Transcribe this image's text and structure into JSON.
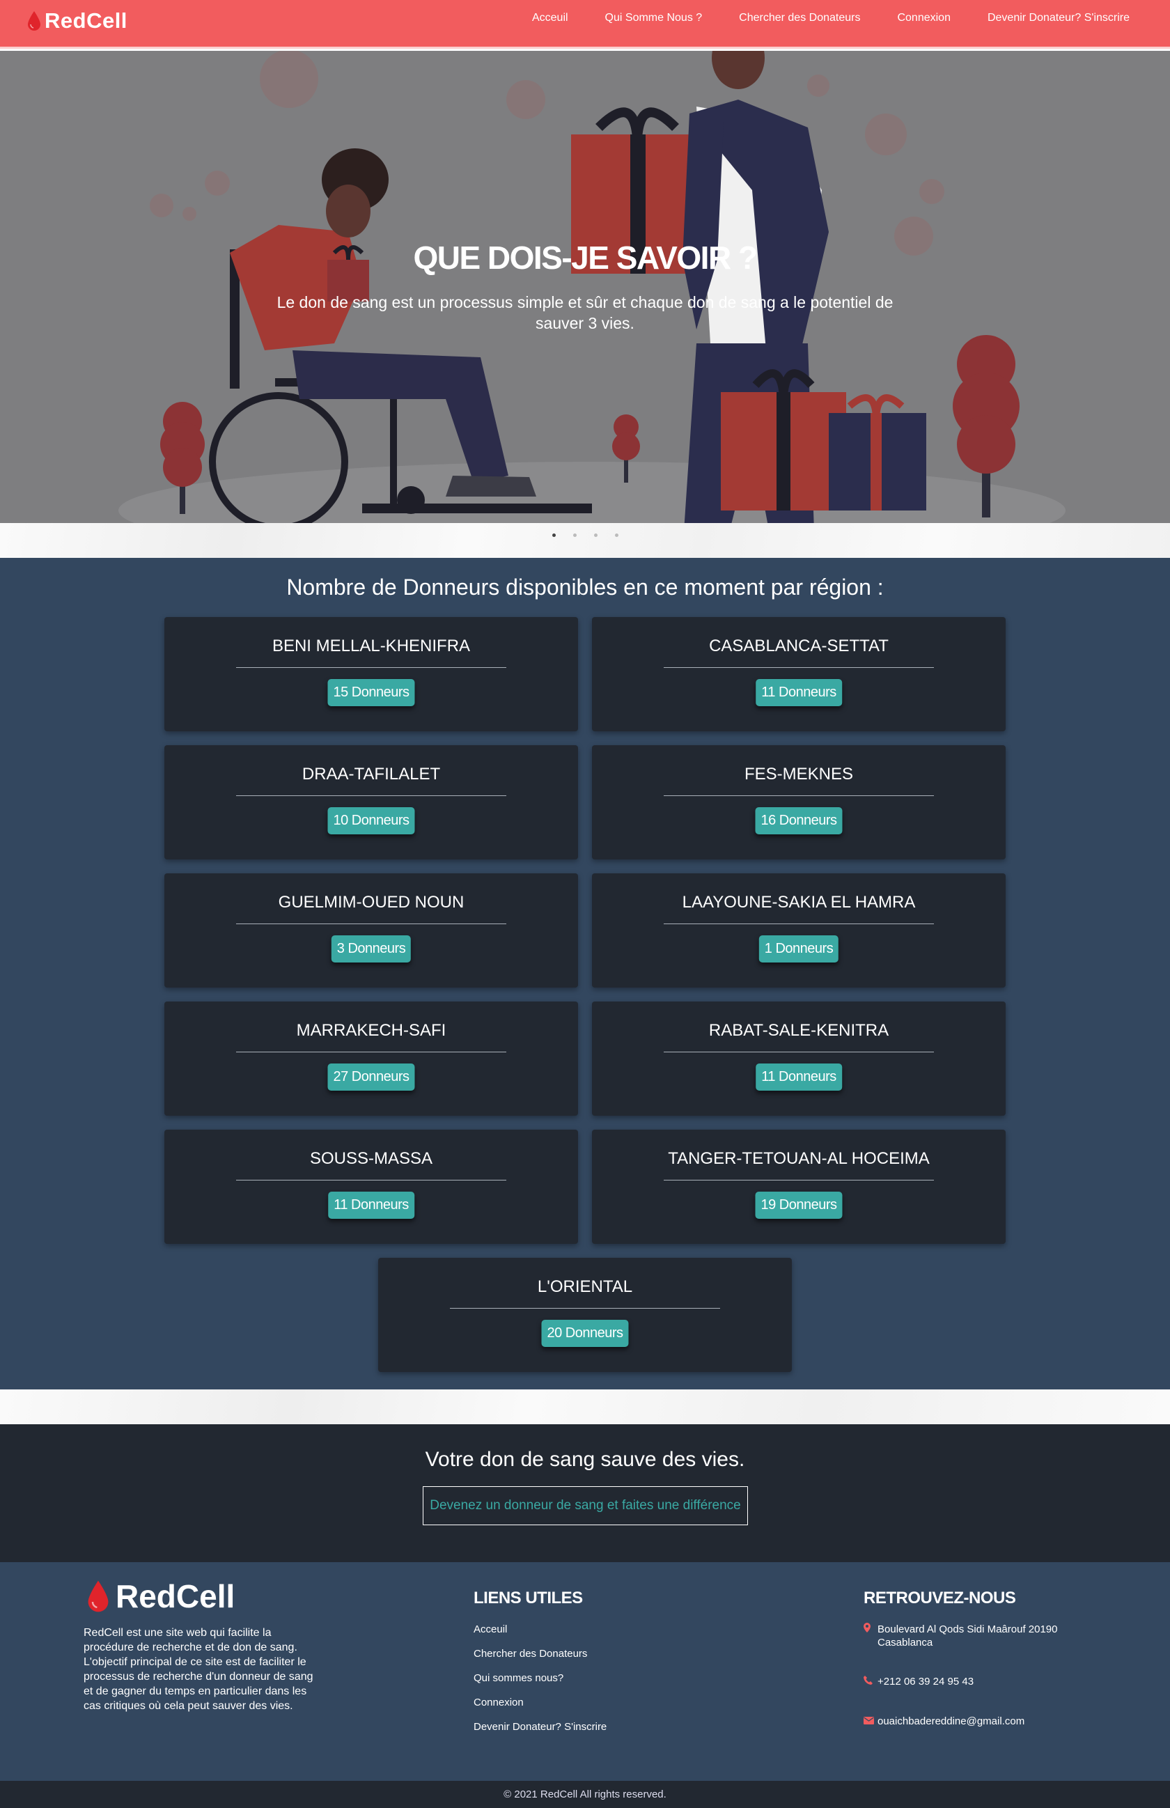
{
  "navbar": {
    "brand": "RedCell",
    "links": [
      "Acceuil",
      "Qui Somme Nous ?",
      "Chercher des Donateurs",
      "Connexion",
      "Devenir Donateur? S'inscrire"
    ]
  },
  "hero": {
    "title": "QUE DOIS-JE SAVOIR ?",
    "subtitle": "Le don de sang est un processus simple et sûr et chaque don de sang a le potentiel de sauver 3 vies.",
    "slide_count": 4,
    "active_slide": 1
  },
  "donors": {
    "heading": "Nombre de Donneurs disponibles en ce moment par région :",
    "regions": [
      {
        "name": "BENI MELLAL-KHENIFRA",
        "count": "15 Donneurs"
      },
      {
        "name": "CASABLANCA-SETTAT",
        "count": "11 Donneurs"
      },
      {
        "name": "DRAA-TAFILALET",
        "count": "10 Donneurs"
      },
      {
        "name": "FES-MEKNES",
        "count": "16 Donneurs"
      },
      {
        "name": "GUELMIM-OUED NOUN",
        "count": "3 Donneurs"
      },
      {
        "name": "LAAYOUNE-SAKIA EL HAMRA",
        "count": "1 Donneurs"
      },
      {
        "name": "MARRAKECH-SAFI",
        "count": "27 Donneurs"
      },
      {
        "name": "RABAT-SALE-KENITRA",
        "count": "11 Donneurs"
      },
      {
        "name": "SOUSS-MASSA",
        "count": "11 Donneurs"
      },
      {
        "name": "TANGER-TETOUAN-AL HOCEIMA",
        "count": "19 Donneurs"
      },
      {
        "name": "L'ORIENTAL",
        "count": "20 Donneurs"
      }
    ]
  },
  "cta": {
    "text": "Votre don de sang sauve des vies.",
    "button": "Devenez un donneur de sang et faites une différence"
  },
  "footer": {
    "brand": "RedCell",
    "description": "RedCell est une site web qui facilite la procédure de recherche et de don de sang. L'objectif principal de ce site est de faciliter le processus de recherche d'un donneur de sang et de gagner du temps en particulier dans les cas critiques où cela peut sauver des vies.",
    "links_title": "LIENS UTILES",
    "links": [
      "Acceuil",
      "Chercher des Donateurs",
      "Qui sommes nous?",
      "Connexion",
      "Devenir Donateur? S'inscrire"
    ],
    "contact_title": "RETROUVEZ-NOUS",
    "address": "Boulevard Al Qods Sidi Maârouf 20190 Casablanca",
    "phone": "+212 06 39 24 95 43",
    "email": "ouaichbadereddine@gmail.com",
    "copyright": "© 2021 RedCell All rights reserved."
  },
  "colors": {
    "navbar": "#f25c5e",
    "accent_teal": "#3aa9a3",
    "section_blue": "#33475f",
    "dark": "#222831"
  },
  "icons": [
    "blood-drop-icon",
    "map-pin-icon",
    "phone-icon",
    "envelope-icon"
  ]
}
